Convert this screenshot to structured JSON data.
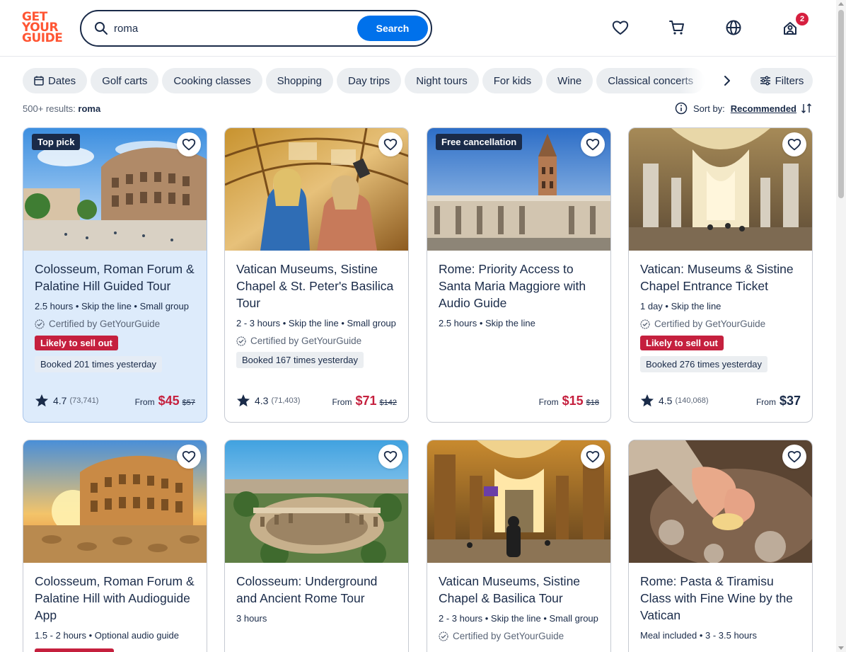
{
  "brand": {
    "line1": "GET",
    "line2": "YOUR",
    "line3": "GUIDE",
    "color": "#ff5533"
  },
  "search": {
    "value": "roma",
    "button": "Search"
  },
  "header_icons": [
    "heart-icon",
    "cart-icon",
    "globe-icon",
    "profile-icon"
  ],
  "cart_badge": "2",
  "chips": [
    "Dates",
    "Golf carts",
    "Cooking classes",
    "Shopping",
    "Day trips",
    "Night tours",
    "For kids",
    "Wine",
    "Classical concerts"
  ],
  "filters_label": "Filters",
  "results": {
    "count": "500+ results:",
    "query": "roma"
  },
  "sort": {
    "label": "Sort by:",
    "value": "Recommended"
  },
  "cards": [
    {
      "tag": "Top pick",
      "title": "Colosseum, Roman Forum & Palatine Hill Guided Tour",
      "meta": "2.5 hours • Skip the line • Small group",
      "cert": "Certified by GetYourGuide",
      "sell": "Likely to sell out",
      "booked": "Booked 201 times yesterday",
      "rating": "4.7",
      "reviews": "(73,741)",
      "from": "From",
      "price": "$45",
      "old": "$57"
    },
    {
      "title": "Vatican Museums, Sistine Chapel & St. Peter's Basilica Tour",
      "meta": "2 - 3 hours • Skip the line • Small group",
      "cert": "Certified by GetYourGuide",
      "booked": "Booked 167 times yesterday",
      "rating": "4.3",
      "reviews": "(71,403)",
      "from": "From",
      "price": "$71",
      "old": "$142"
    },
    {
      "tag": "Free cancellation",
      "title": "Rome: Priority Access to Santa Maria Maggiore with Audio Guide",
      "meta": "2.5 hours • Skip the line",
      "from": "From",
      "price": "$15",
      "old": "$18"
    },
    {
      "title": "Vatican: Museums & Sistine Chapel Entrance Ticket",
      "meta": "1 day • Skip the line",
      "cert": "Certified by GetYourGuide",
      "sell": "Likely to sell out",
      "booked": "Booked 276 times yesterday",
      "rating": "4.5",
      "reviews": "(140,068)",
      "from": "From",
      "price": "$37"
    },
    {
      "title": "Colosseum, Roman Forum & Palatine Hill with Audioguide App",
      "meta": "1.5 - 2 hours • Optional audio guide"
    },
    {
      "title": "Colosseum: Underground and Ancient Rome Tour",
      "meta": "3 hours"
    },
    {
      "title": "Vatican Museums, Sistine Chapel & Basilica Tour",
      "meta": "2 - 3 hours • Skip the line • Small group",
      "cert": "Certified by GetYourGuide"
    },
    {
      "title": "Rome: Pasta & Tiramisu Class with Fine Wine by the Vatican",
      "meta": "Meal included • 3 - 3.5 hours"
    }
  ]
}
